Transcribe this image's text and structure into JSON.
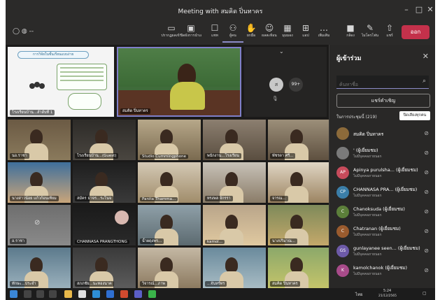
{
  "window": {
    "title": "Meeting with สมคิด ปิ่นทาคร",
    "minimize": "–",
    "maximize": "□",
    "close": "✕"
  },
  "toolbar": {
    "timer": "◯  ◍  --",
    "items": [
      {
        "label": "ปรากฏผลเข้า",
        "icon": "layout-icon"
      },
      {
        "label": "ปิดผังการนำเสนอ",
        "icon": "whiteboard-icon"
      },
      {
        "label": "แชท",
        "icon": "chat-icon"
      },
      {
        "label": "ผู้คน",
        "icon": "people-icon"
      },
      {
        "label": "ยกมือ",
        "icon": "raise-hand-icon"
      },
      {
        "label": "ผลสะท้อน",
        "icon": "reaction-icon"
      },
      {
        "label": "มุมมอง",
        "icon": "view-icon"
      },
      {
        "label": "แอป",
        "icon": "apps-icon"
      },
      {
        "label": "เพิ่มเติม",
        "icon": "more-icon"
      },
      {
        "label": "กล้อง",
        "icon": "camera-icon"
      },
      {
        "label": "ไมโครโฟน",
        "icon": "mic-off-icon"
      },
      {
        "label": "แชร์",
        "icon": "share-icon"
      }
    ],
    "leave_label": "ออก"
  },
  "stage": {
    "presentation_title": "การวิจัยในชั้นเรียนแบบง่าย",
    "presenter_name": "สมคิด ปิ่นทาคร",
    "overflow_initial": "ส",
    "overflow_count": "99+",
    "slide_presenter_label": "โรงเรียนบ้าน...ลำดับที่ 1",
    "tiles": [
      {
        "name": "นอ.ราชา"
      },
      {
        "name": "โรงเรียนบ้าน...(Guest)"
      },
      {
        "name": "Studio Cummingphone"
      },
      {
        "name": "พนักงาน...โรงเรียน"
      },
      {
        "name": "พัชรดา ศรี..."
      },
      {
        "name": "นางสาวน้อย แก้วก้อนเทียม"
      },
      {
        "name": "สมัคร ธาจร...ระโนจ"
      },
      {
        "name": "Panita Thamma..."
      },
      {
        "name": "ทรงพล จักรรา"
      },
      {
        "name": "จารณ..."
      },
      {
        "name": "อ.ราชา"
      },
      {
        "name": "CHANNASA PRANGTHONG"
      },
      {
        "name": "น้ำผดุงพร..."
      },
      {
        "name": "kamol..."
      },
      {
        "name": "นางปริมาณ..."
      },
      {
        "name": "ทักษะ...ประจำ"
      },
      {
        "name": "สภภชัย...นะทองนาค"
      },
      {
        "name": "วิจารณ์...ภาพ"
      },
      {
        "name": "...จันทร์ทร"
      },
      {
        "name": "สมคิด ปิ่นทาคร"
      }
    ]
  },
  "panel": {
    "title": "ผู้เข้าร่วม",
    "search_placeholder": "ค้นหาชื่อ",
    "share_invite": "แชร์คำเชิญ",
    "section_label": "ในการประชุมนี้ (219)",
    "mute_all": "ปิดเสียงทุกคน",
    "participants": [
      {
        "initials": "",
        "name": "สมคิด ปิ่นทาคร",
        "status": "",
        "color": "#8c6a3a"
      },
      {
        "initials": "",
        "name": "' (ผู้เยี่ยมชม)",
        "status": "ไม่มีบุคคลภายนอก",
        "color": "#7a7a7a"
      },
      {
        "initials": "AP",
        "name": "Apinya purulsha... (ผู้เยี่ยมชม)",
        "status": "ไม่มีบุคคลภายนอก",
        "color": "#c74b5b"
      },
      {
        "initials": "CP",
        "name": "CHANNASA PRA... (ผู้เยี่ยมชม)",
        "status": "ไม่มีบุคคลภายนอก",
        "color": "#3b7ea8"
      },
      {
        "initials": "C",
        "name": "Chanoksuda (ผู้เยี่ยมชม)",
        "status": "ไม่มีบุคคลภายนอก",
        "color": "#5c7f3a"
      },
      {
        "initials": "C",
        "name": "Chatranan (ผู้เยี่ยมชม)",
        "status": "ไม่มีบุคคลภายนอก",
        "color": "#9a5b2e"
      },
      {
        "initials": "GS",
        "name": "gunlayanee seen... (ผู้เยี่ยมชม)",
        "status": "ไม่มีบุคคลภายนอก",
        "color": "#6d5aa8"
      },
      {
        "initials": "K",
        "name": "kamolchanok (ผู้เยี่ยมชม)",
        "status": "ไม่มีบุคคลภายนอก",
        "color": "#a84b8a"
      }
    ]
  },
  "taskbar": {
    "lang": "ไทย",
    "time": "5:24",
    "date": "21/12/2565"
  }
}
